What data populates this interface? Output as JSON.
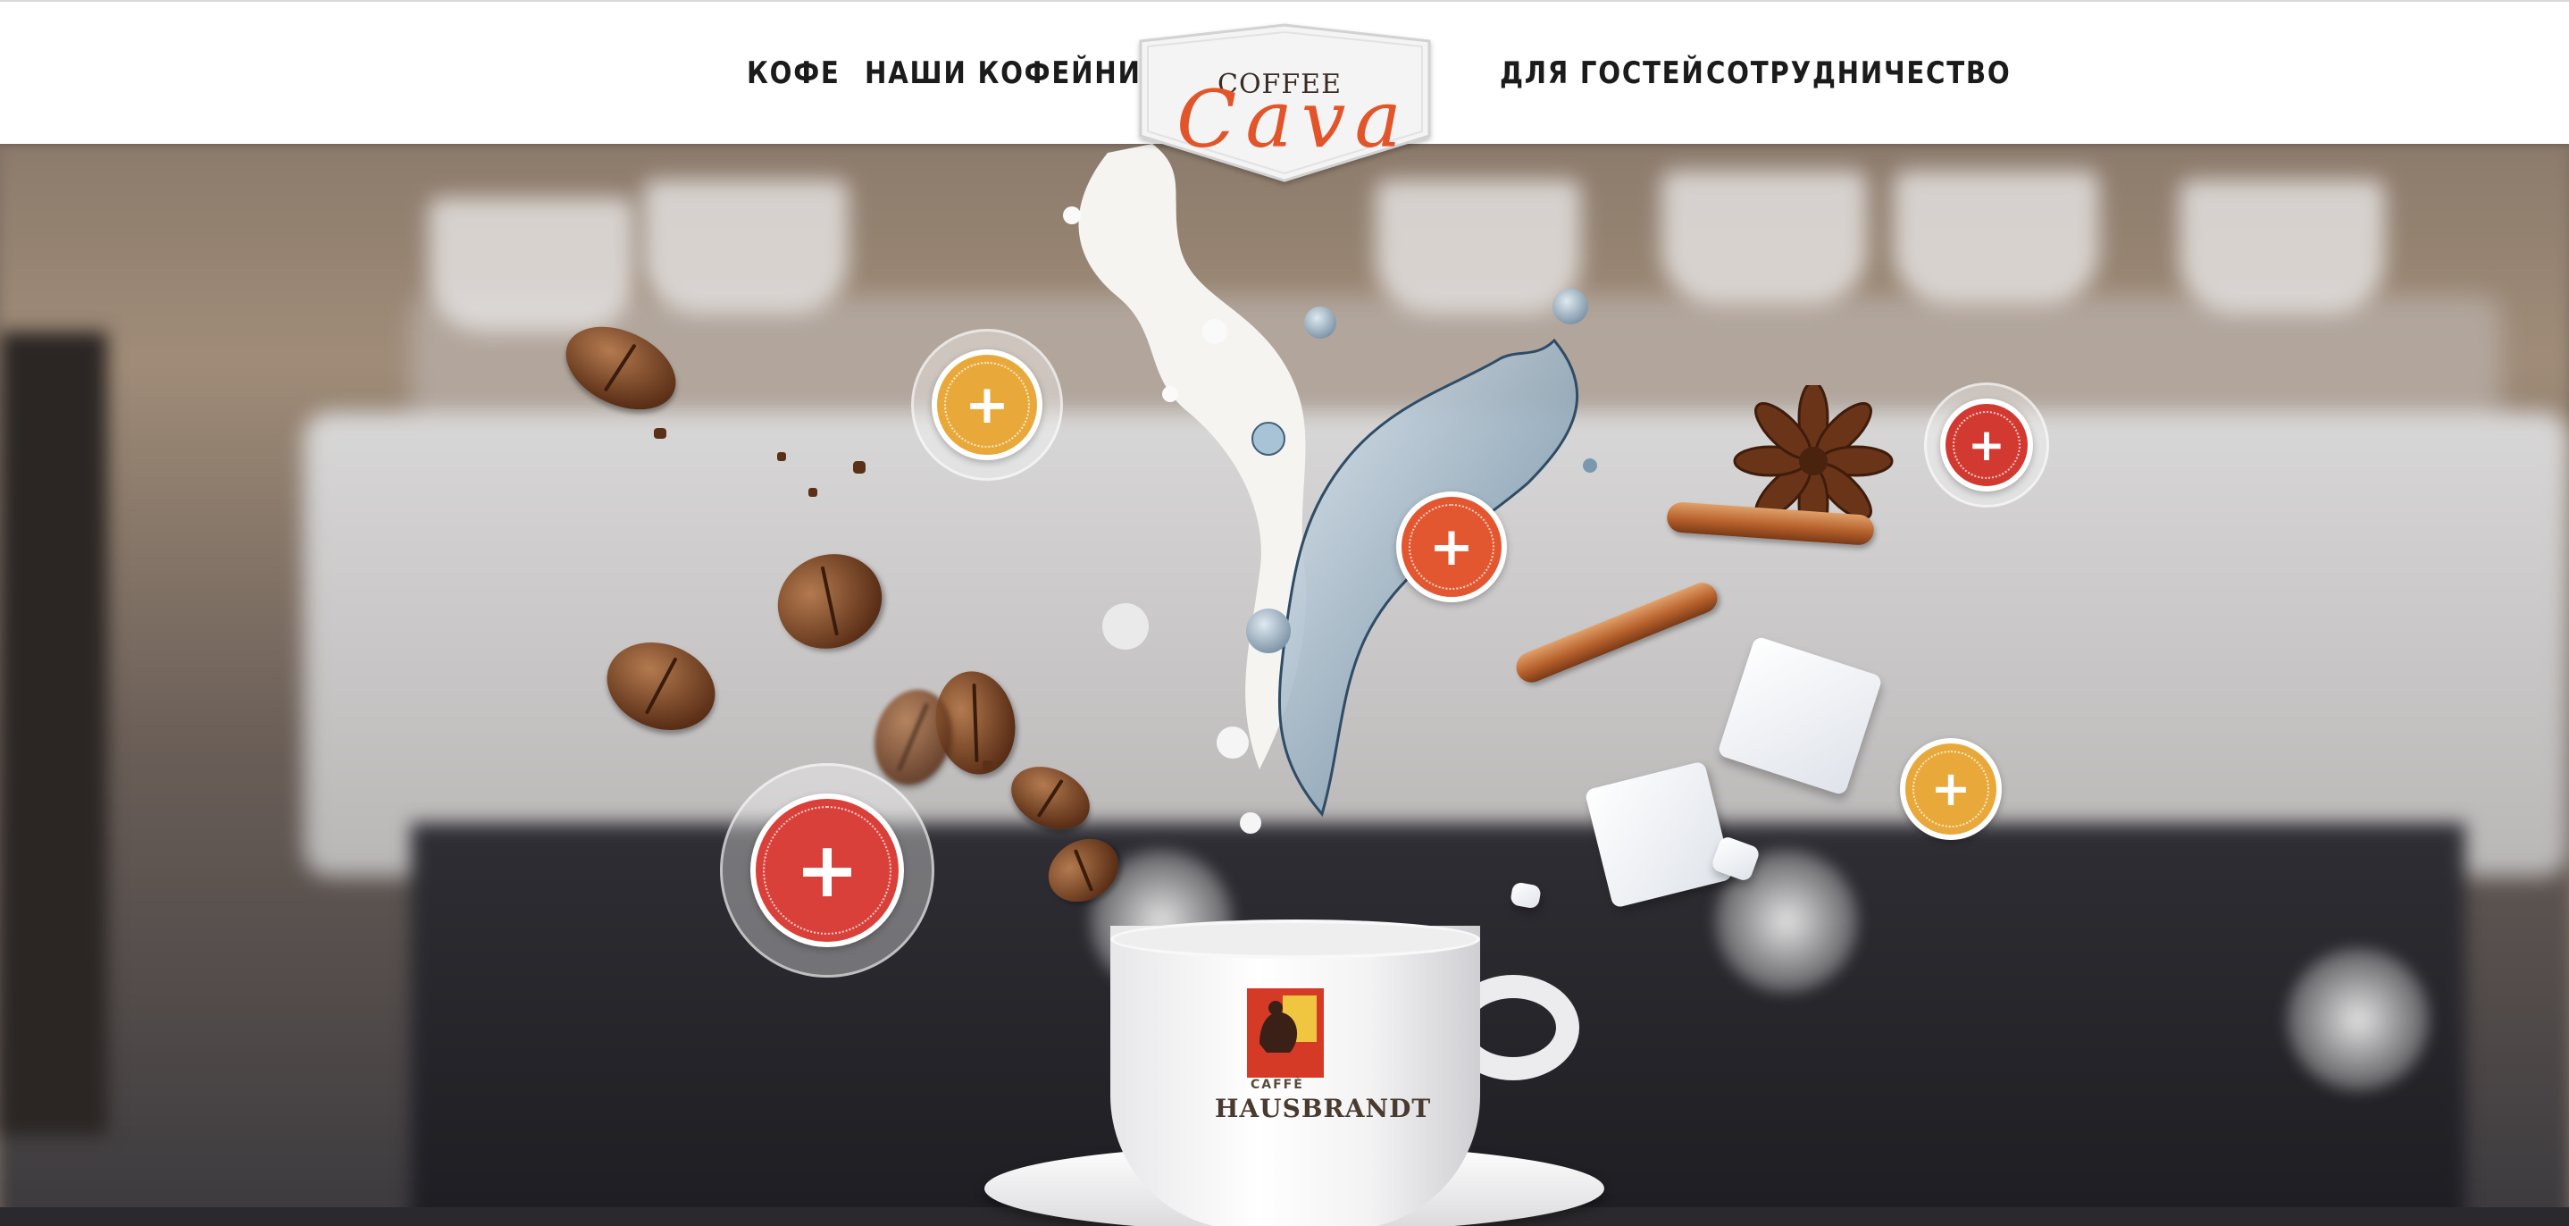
{
  "nav": {
    "items": [
      {
        "id": "coffee",
        "label": "КОФЕ"
      },
      {
        "id": "cafes",
        "label": "НАШИ КОФЕЙНИ"
      },
      {
        "id": "guests",
        "label": "ДЛЯ ГОСТЕЙ"
      },
      {
        "id": "partners",
        "label": "СОТРУДНИЧЕСТВО"
      }
    ]
  },
  "logo": {
    "top_word": "COFFEE",
    "brand_word": "Cava",
    "icon": "coffee-cava-logo"
  },
  "cup": {
    "brand_small": "CAFFÈ",
    "brand_name": "HAUSBRANDT"
  },
  "hotspots": [
    {
      "id": "orange-top-left",
      "icon": "plus-icon",
      "glyph": "+",
      "color": "#e8a93a"
    },
    {
      "id": "red-top-right",
      "icon": "plus-icon",
      "glyph": "+",
      "color": "#d23a31"
    },
    {
      "id": "orange-red-center",
      "icon": "plus-icon",
      "glyph": "+",
      "color": "#e2572f"
    },
    {
      "id": "orange-bottom-right",
      "icon": "plus-icon",
      "glyph": "+",
      "color": "#e8a93a"
    },
    {
      "id": "red-bottom-left",
      "icon": "plus-icon",
      "glyph": "+",
      "color": "#d9403a"
    }
  ],
  "colors": {
    "header_bg": "#ffffff",
    "nav_text": "#1b1b1b",
    "brand_orange": "#e2552b",
    "hotspot_orange": "#e8a93a",
    "hotspot_red": "#d23a31"
  }
}
